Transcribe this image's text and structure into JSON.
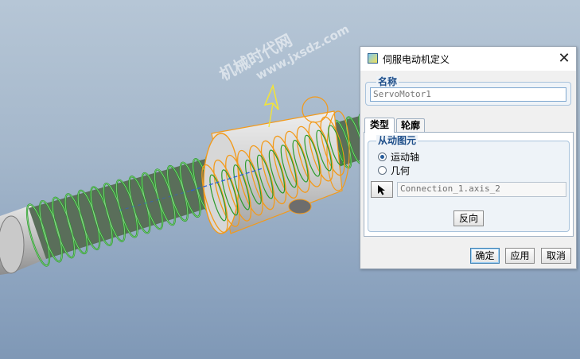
{
  "watermark": {
    "text": "机械时代网",
    "url": "www.jxsdz.com"
  },
  "dialog": {
    "title": "伺服电动机定义",
    "close_glyph": "✕",
    "name_group": {
      "label": "名称",
      "value": "ServoMotor1"
    },
    "tabs": [
      {
        "label": "类型",
        "active": true
      },
      {
        "label": "轮廓",
        "active": false
      }
    ],
    "driven_entity": {
      "label": "从动图元",
      "options": [
        {
          "label": "运动轴",
          "checked": true
        },
        {
          "label": "几何",
          "checked": false
        }
      ],
      "reference_value": "Connection_1.axis_2"
    },
    "flip_label": "反向",
    "buttons": {
      "ok": "确定",
      "apply": "应用",
      "cancel": "取消"
    }
  },
  "colors": {
    "coil_green": "#2a9a2a",
    "highlight_orange": "#f39a1a",
    "part_gray": "#b9b9b9",
    "accent_blue": "#1f4f8a"
  },
  "icons": {
    "app": "window-icon",
    "close": "close-icon",
    "select": "arrow-cursor-icon"
  }
}
